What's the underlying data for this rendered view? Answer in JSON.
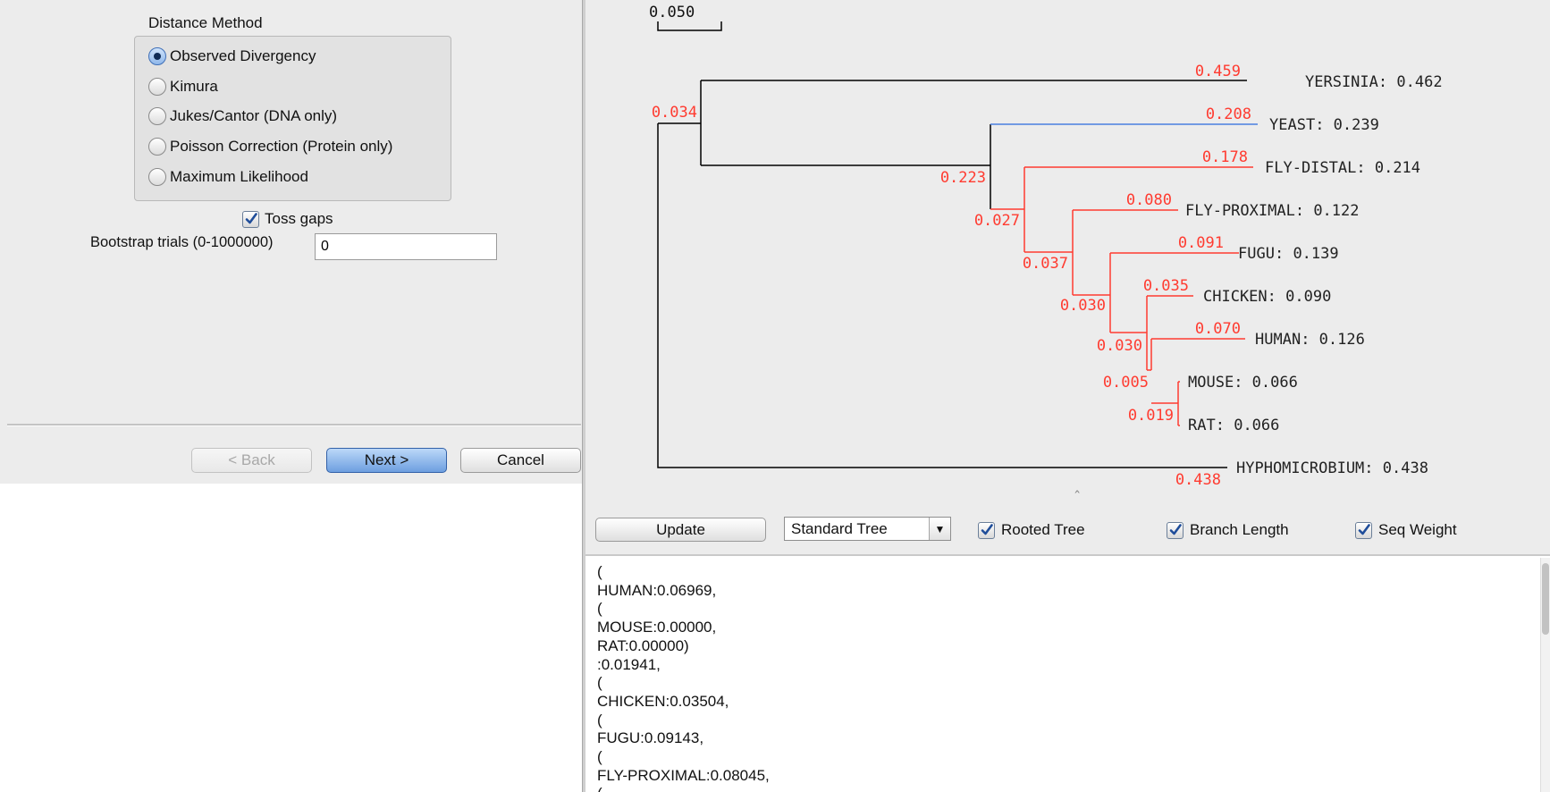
{
  "distance_method": {
    "title": "Distance Method",
    "options": [
      {
        "label": "Observed Divergency",
        "selected": true
      },
      {
        "label": "Kimura",
        "selected": false
      },
      {
        "label": "Jukes/Cantor (DNA only)",
        "selected": false
      },
      {
        "label": "Poisson Correction (Protein only)",
        "selected": false
      },
      {
        "label": "Maximum Likelihood",
        "selected": false
      }
    ]
  },
  "toss_gaps": {
    "label": "Toss gaps",
    "checked": true
  },
  "bootstrap": {
    "label": "Bootstrap trials (0-1000000)",
    "value": "0"
  },
  "wizard_buttons": {
    "back": "< Back",
    "next": "Next >",
    "cancel": "Cancel"
  },
  "tree": {
    "scale_label": "0.050",
    "leaves": [
      {
        "name": "YERSINIA",
        "value": "0.462",
        "branch": "0.459"
      },
      {
        "name": "YEAST",
        "value": "0.239",
        "branch": "0.208"
      },
      {
        "name": "FLY-DISTAL",
        "value": "0.214",
        "branch": "0.178"
      },
      {
        "name": "FLY-PROXIMAL",
        "value": "0.122",
        "branch": "0.080"
      },
      {
        "name": "FUGU",
        "value": "0.139",
        "branch": "0.091"
      },
      {
        "name": "CHICKEN",
        "value": "0.090",
        "branch": "0.035"
      },
      {
        "name": "HUMAN",
        "value": "0.126",
        "branch": "0.070"
      },
      {
        "name": "MOUSE",
        "value": "0.066",
        "branch": ""
      },
      {
        "name": "RAT",
        "value": "0.066",
        "branch": ""
      },
      {
        "name": "HYPHOMICROBIUM",
        "value": "0.438",
        "branch": "0.438"
      }
    ],
    "internal_labels": [
      "0.034",
      "0.223",
      "0.027",
      "0.037",
      "0.030",
      "0.030",
      "0.005",
      "0.019"
    ],
    "colors": {
      "black": "#000000",
      "red": "#ff3b30",
      "blue": "#4a7fe0"
    }
  },
  "tree_toolbar": {
    "update": "Update",
    "tree_type": "Standard Tree",
    "rooted": {
      "label": "Rooted Tree",
      "checked": true
    },
    "branch_length": {
      "label": "Branch Length",
      "checked": true
    },
    "seq_weight": {
      "label": "Seq Weight",
      "checked": true
    }
  },
  "newick_lines": [
    "(",
    "HUMAN:0.06969,",
    "(",
    "MOUSE:0.00000,",
    "RAT:0.00000)",
    ":0.01941,",
    "(",
    "CHICKEN:0.03504,",
    "(",
    "FUGU:0.09143,",
    "(",
    "FLY-PROXIMAL:0.08045,",
    "("
  ]
}
